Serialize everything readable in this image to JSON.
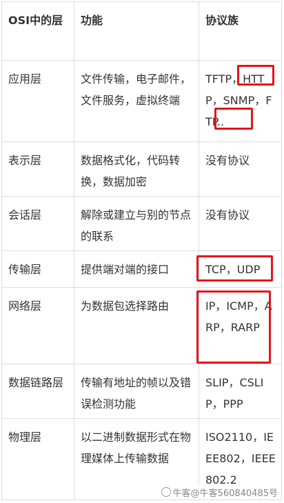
{
  "table": {
    "headers": [
      "OSI中的层",
      "功能",
      "协议族"
    ],
    "rows": [
      {
        "layer": "应用层",
        "function": "文件传输，电子邮件，文件服务，虚拟终端",
        "protocols": "TFTP，HTTP，SNMP，FTP.."
      },
      {
        "layer": "表示层",
        "function": "数据格式化，代码转换，数据加密",
        "protocols": "没有协议"
      },
      {
        "layer": "会话层",
        "function": "解除或建立与别的节点的联系",
        "protocols": "没有协议"
      },
      {
        "layer": "传输层",
        "function": "提供端对端的接口",
        "protocols": "TCP，UDP"
      },
      {
        "layer": "网络层",
        "function": "为数据包选择路由",
        "protocols": "IP，ICMP，ARP，RARP"
      },
      {
        "layer": "数据链路层",
        "function": "传输有地址的帧以及错误检测功能",
        "protocols": "SLIP，CSLIP，PPP"
      },
      {
        "layer": "物理层",
        "function": "以二进制数据形式在物理媒体上传输数据",
        "protocols": "ISO2110，IEEE802，IEEE802.2"
      }
    ]
  },
  "highlight_color": "#e5141a",
  "watermark": "牛客@牛客560840485号"
}
